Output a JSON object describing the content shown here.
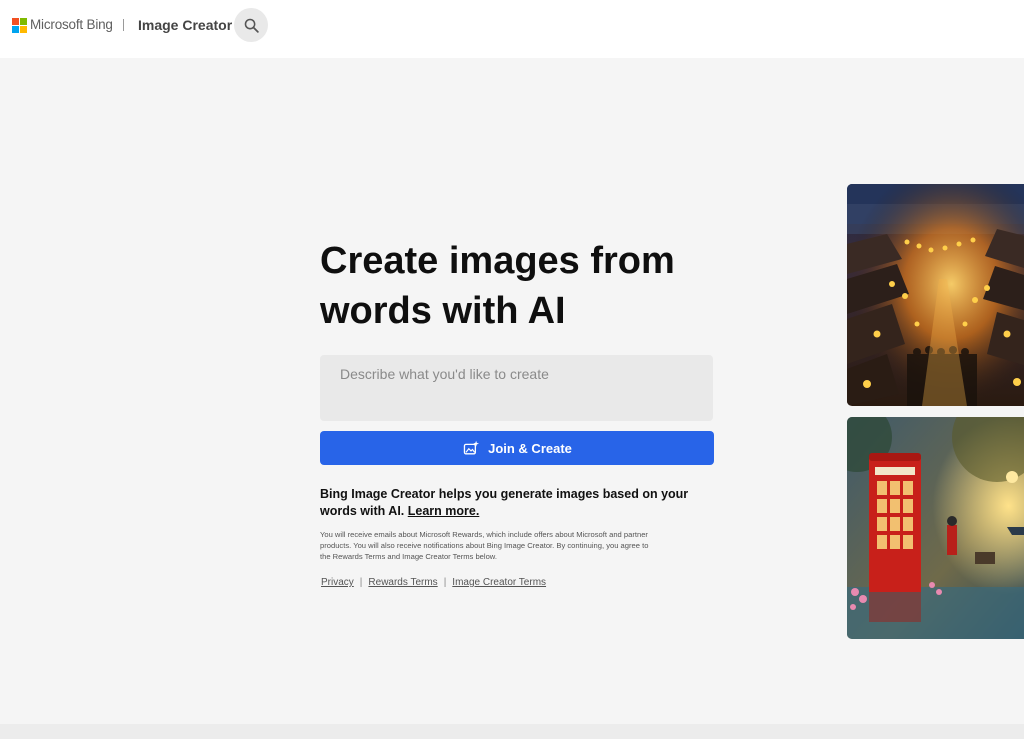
{
  "header": {
    "brand": "Microsoft Bing",
    "product": "Image Creator",
    "search_icon": "search-icon",
    "logo_colors": [
      "#f25022",
      "#7fba00",
      "#00a4ef",
      "#ffb900"
    ]
  },
  "hero": {
    "title": "Create images from words with AI",
    "prompt_placeholder": "Describe what you'd like to create",
    "prompt_value": "",
    "button_label": "Join & Create",
    "button_icon": "image-sparkle-icon",
    "accent_color": "#2864e8"
  },
  "info": {
    "helper_text": "Bing Image Creator helps you generate images based on your words with AI.",
    "learn_more": "Learn more.",
    "fineprint": "You will receive emails about Microsoft Rewards, which include offers about Microsoft and partner products. You will also receive notifications about Bing Image Creator. By continuing, you agree to the Rewards Terms and Image Creator Terms below."
  },
  "links": {
    "privacy": "Privacy",
    "rewards_terms": "Rewards Terms",
    "image_creator_terms": "Image Creator Terms",
    "separator": "|"
  },
  "gallery": [
    {
      "name": "lantern-festival-street-image"
    },
    {
      "name": "red-phone-booth-rainy-street-image"
    }
  ]
}
